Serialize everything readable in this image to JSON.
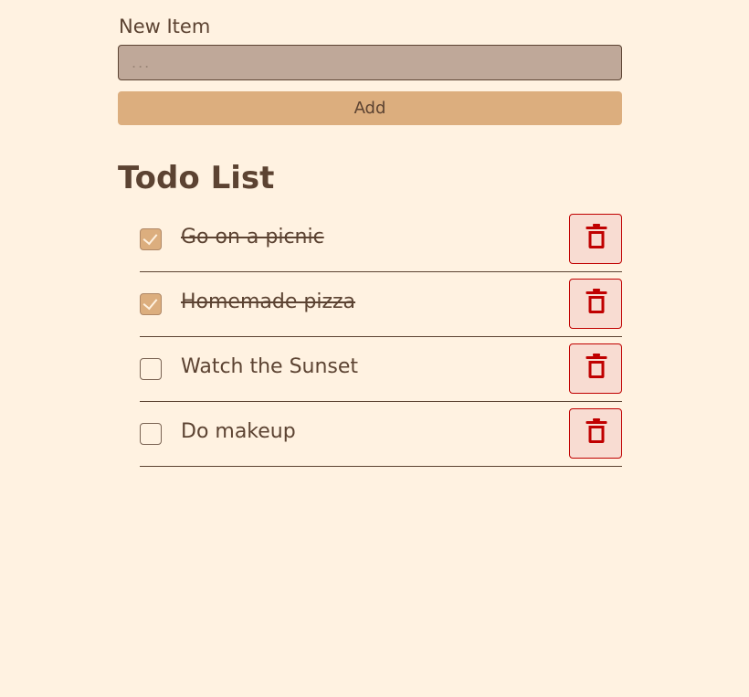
{
  "form": {
    "label": "New Item",
    "input_value": "",
    "input_placeholder": "...",
    "add_label": "Add"
  },
  "list": {
    "title": "Todo List",
    "items": [
      {
        "label": "Go on a picnic",
        "checked": true
      },
      {
        "label": "Homemade pizza",
        "checked": true
      },
      {
        "label": "Watch the Sunset",
        "checked": false
      },
      {
        "label": "Do makeup",
        "checked": false
      }
    ]
  },
  "icons": {
    "delete": "trash-icon",
    "check": "checkmark-icon"
  },
  "colors": {
    "background": "#fff2e1",
    "text": "#5c4332",
    "input_bg": "#bfa899",
    "accent": "#dcae7e",
    "delete_border": "#c00000",
    "delete_bg": "#f8dcd2"
  }
}
